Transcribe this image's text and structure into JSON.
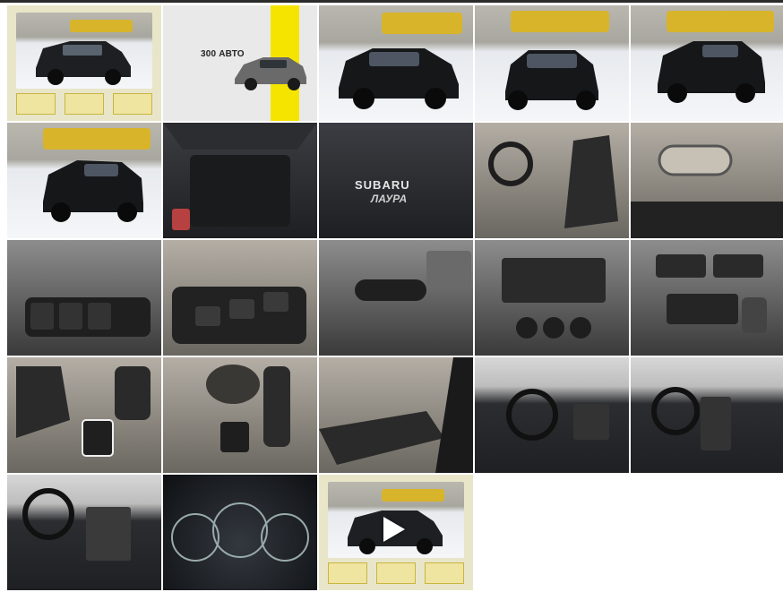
{
  "colors": {
    "accent_yellow": "#f5e400",
    "top_bar": "#2b2b2b",
    "background": "#ffffff"
  },
  "promo": {
    "heading": "300 АВТО"
  },
  "badges": {
    "brand": "SUBARU",
    "dealer": "ЛАУРА"
  },
  "gallery": {
    "tiles": [
      {
        "content": "promo-framed-exterior",
        "icon": "photo"
      },
      {
        "content": "promo-banner",
        "icon": "photo"
      },
      {
        "content": "exterior-front-left",
        "icon": "photo"
      },
      {
        "content": "exterior-front",
        "icon": "photo"
      },
      {
        "content": "exterior-rear-right",
        "icon": "photo"
      },
      {
        "content": "exterior-rear-left",
        "icon": "photo"
      },
      {
        "content": "trunk-open",
        "icon": "photo"
      },
      {
        "content": "rear-badge",
        "icon": "photo"
      },
      {
        "content": "interior-front-seat",
        "icon": "photo"
      },
      {
        "content": "door-handle",
        "icon": "photo"
      },
      {
        "content": "light-switches",
        "icon": "photo"
      },
      {
        "content": "window-switches",
        "icon": "photo"
      },
      {
        "content": "steering-column-stalk",
        "icon": "photo"
      },
      {
        "content": "radio-climate-panel",
        "icon": "photo"
      },
      {
        "content": "center-console",
        "icon": "photo"
      },
      {
        "content": "gear-lever",
        "icon": "photo"
      },
      {
        "content": "cupholder-console",
        "icon": "photo"
      },
      {
        "content": "door-panel",
        "icon": "photo"
      },
      {
        "content": "dashboard-driver",
        "icon": "photo"
      },
      {
        "content": "dashboard-wide",
        "icon": "photo"
      },
      {
        "content": "dashboard-side",
        "icon": "photo"
      },
      {
        "content": "instrument-cluster",
        "icon": "photo"
      },
      {
        "content": "video-thumbnail",
        "icon": "play-icon"
      }
    ]
  }
}
